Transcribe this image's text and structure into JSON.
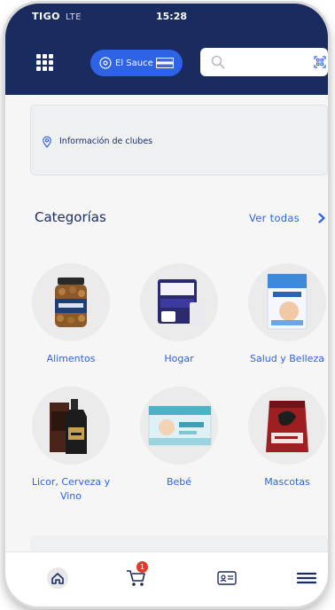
{
  "status_bar": {
    "carrier": "TIGO",
    "network": "LTE",
    "time": "15:28"
  },
  "header": {
    "club_selector": {
      "label": "El Sauce"
    },
    "search": {
      "placeholder": ""
    }
  },
  "clubs_info": {
    "label": "Información de clubes"
  },
  "categories": {
    "title": "Categorías",
    "see_all": "Ver todas",
    "items": [
      {
        "label": "Alimentos",
        "icon": "nuts-jar-icon"
      },
      {
        "label": "Hogar",
        "icon": "paper-towels-icon"
      },
      {
        "label": "Salud y Belleza",
        "icon": "cotton-box-icon"
      },
      {
        "label": "Licor, Cerveza y Vino",
        "icon": "whisky-bottle-icon"
      },
      {
        "label": "Bebé",
        "icon": "diapers-pack-icon"
      },
      {
        "label": "Mascotas",
        "icon": "pet-food-bag-icon"
      }
    ]
  },
  "tab_bar": {
    "items": [
      "home-icon",
      "cart-icon",
      "membership-card-icon",
      "menu-icon"
    ],
    "cart_badge": "1"
  },
  "colors": {
    "header": "#1a2b5f",
    "accent": "#2e63e6",
    "badge": "#e23a2a"
  }
}
